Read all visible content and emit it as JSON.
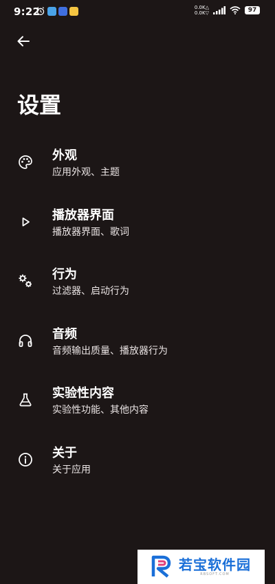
{
  "status_bar": {
    "time": "9:22",
    "net_up": "0.0K",
    "net_down": "0.0K",
    "battery": "97"
  },
  "page": {
    "title": "设置"
  },
  "menu": [
    {
      "icon": "palette-icon",
      "title": "外观",
      "subtitle": "应用外观、主题"
    },
    {
      "icon": "play-icon",
      "title": "播放器界面",
      "subtitle": "播放器界面、歌词"
    },
    {
      "icon": "gears-icon",
      "title": "行为",
      "subtitle": "过滤器、启动行为"
    },
    {
      "icon": "headphones-icon",
      "title": "音频",
      "subtitle": "音频输出质量、播放器行为"
    },
    {
      "icon": "flask-icon",
      "title": "实验性内容",
      "subtitle": "实验性功能、其他内容"
    },
    {
      "icon": "info-icon",
      "title": "关于",
      "subtitle": "关于应用"
    }
  ],
  "watermark": {
    "title": "若宝软件园",
    "subtitle": "RBSOFT.COM"
  },
  "colors": {
    "background": "#1c1616",
    "text": "#ffffff",
    "watermark_blue": "#1a6fd8"
  }
}
